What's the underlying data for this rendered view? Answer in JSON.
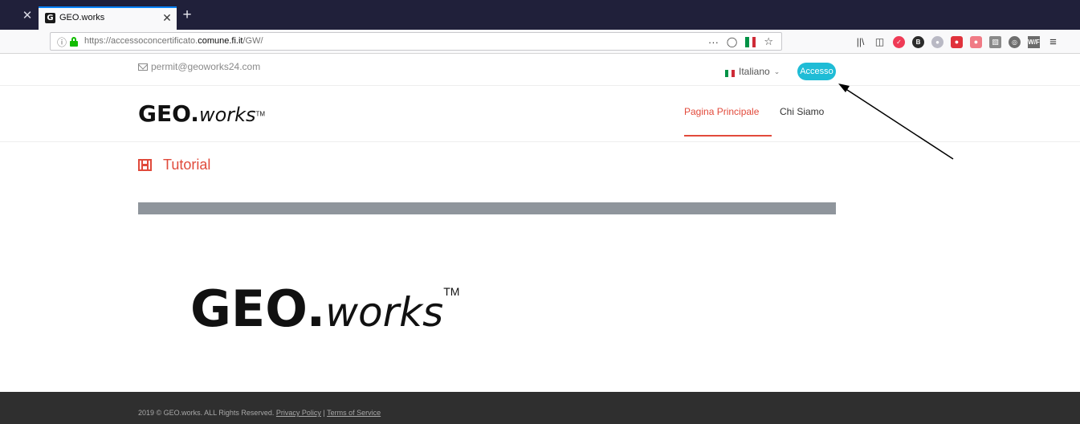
{
  "browser": {
    "window_close": "✕",
    "tab": {
      "favicon_letter": "G",
      "title": "GEO.works",
      "close": "✕"
    },
    "new_tab": "+",
    "url": {
      "prefix": "https://accessoconcertificato.",
      "domain": "comune.fi.it",
      "path": "/GW/"
    },
    "page_actions": {
      "more": "···",
      "pocket": "pocket-icon",
      "flag": "italian-flag-icon",
      "bookmark": "☆"
    },
    "toolbar_icons": [
      "library-icon",
      "sidebar-icon",
      "pocket-red-icon",
      "extension-b-icon",
      "extension-round-icon",
      "extension-red-icon",
      "extension-pink-icon",
      "extension-gray-icon",
      "extension-globe-icon",
      "wf-extension-icon",
      "menu-icon"
    ]
  },
  "site": {
    "email": "permit@geoworks24.com",
    "language": "Italiano",
    "login_button": "Accesso",
    "logo": {
      "geo": "GEO.",
      "works": "works",
      "tm": "TM"
    },
    "nav": {
      "home": "Pagina Principale",
      "about": "Chi Siamo"
    },
    "section_title": "Tutorial",
    "footer": {
      "copyright": "2019 © GEO.works. ALL Rights Reserved.",
      "privacy": "Privacy Policy",
      "separator": "|",
      "terms": "Terms of Service"
    }
  },
  "colors": {
    "accent_red": "#e24a3b",
    "login_cyan": "#1fbcd6",
    "tab_strip": "#20203a",
    "footer_bg": "#2f2f2f"
  }
}
